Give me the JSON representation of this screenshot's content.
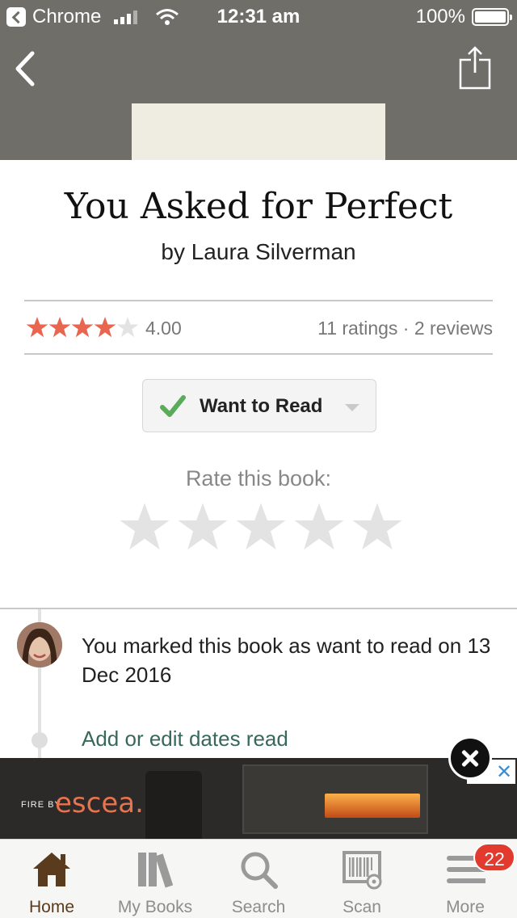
{
  "status_bar": {
    "back_app": "Chrome",
    "time": "12:31 am",
    "battery": "100%"
  },
  "book": {
    "title": "You Asked for Perfect",
    "author": "by Laura Silverman",
    "average_rating": "4.00",
    "rating_stars": 4,
    "counts": "11 ratings · 2 reviews"
  },
  "shelf_button": {
    "label": "Want to Read"
  },
  "rate": {
    "label": "Rate this book:",
    "star_count": 5
  },
  "activity": {
    "marked_text": "You marked this book as want to read on 13 Dec 2016",
    "edit_link": "Add or edit dates read"
  },
  "ad": {
    "brand_prefix": "FIRE BY",
    "brand": "escea."
  },
  "tabs": [
    {
      "label": "Home",
      "icon": "home-icon",
      "active": true
    },
    {
      "label": "My Books",
      "icon": "books-icon",
      "active": false
    },
    {
      "label": "Search",
      "icon": "search-icon",
      "active": false
    },
    {
      "label": "Scan",
      "icon": "scan-icon",
      "active": false
    },
    {
      "label": "More",
      "icon": "menu-icon",
      "active": false
    }
  ],
  "more_badge": "22",
  "colors": {
    "header": "#6f6e69",
    "star_filled": "#e8664f",
    "star_empty": "#e3e3e3",
    "check": "#5aab5a",
    "link": "#38675c",
    "tab_active": "#5a3b1e",
    "badge": "#e23a2e"
  }
}
